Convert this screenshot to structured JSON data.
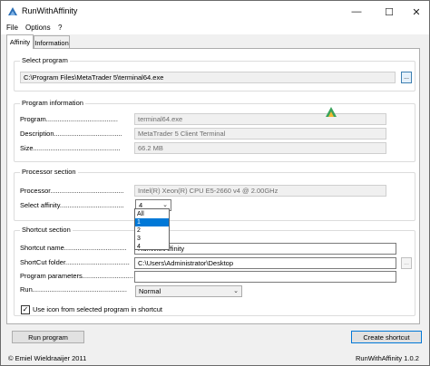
{
  "window": {
    "title": "RunWithAffinity",
    "minimize_glyph": "—",
    "maximize_glyph": "☐",
    "close_glyph": "✕"
  },
  "menu": [
    "File",
    "Options",
    "?"
  ],
  "tabs": [
    {
      "label": "Affinity",
      "active": true
    },
    {
      "label": "Information",
      "active": false
    }
  ],
  "select_program": {
    "title": "Select program",
    "path": "C:\\Program Files\\MetaTrader 5\\terminal64.exe",
    "browse_label": "..."
  },
  "program_information": {
    "title": "Program information",
    "program_label": "Program......................................",
    "program_value": "terminal64.exe",
    "description_label": "Description....................................",
    "description_value": "MetaTrader 5 Client Terminal",
    "size_label": "Size..............................................",
    "size_value": "66.2 MB"
  },
  "processor_section": {
    "title": "Processor section",
    "processor_label": "Processor.......................................",
    "processor_value": "Intel(R) Xeon(R) CPU E5-2660 v4 @ 2.00GHz",
    "affinity_label": "Select affinity..................................",
    "affinity_value": "4",
    "affinity_options": [
      "All",
      "1",
      "2",
      "3",
      "4"
    ],
    "affinity_highlighted": "1"
  },
  "shortcut_section": {
    "title": "Shortcut section",
    "name_label": "Shortcut name.................................",
    "name_value": "RunWithAffinity",
    "folder_label": "ShortCut folder..................................",
    "folder_value": "C:\\Users\\Administrator\\Desktop",
    "params_label": "Program parameters...........................",
    "params_value": "",
    "run_label": "Run..................................................",
    "run_value": "Normal",
    "browse_label": "...",
    "use_icon_label": "Use icon from selected program in shortcut",
    "use_icon_checked": "✓"
  },
  "buttons": {
    "run_program": "Run program",
    "create_shortcut": "Create shortcut"
  },
  "status": {
    "copyright": "© Emiel Wieldraaijer 2011",
    "version": "RunWithAffinity 1.0.2"
  },
  "colors": {
    "accent": "#0078d7",
    "window_bg": "#f0f0f0",
    "panel_bg": "#ffffff"
  }
}
